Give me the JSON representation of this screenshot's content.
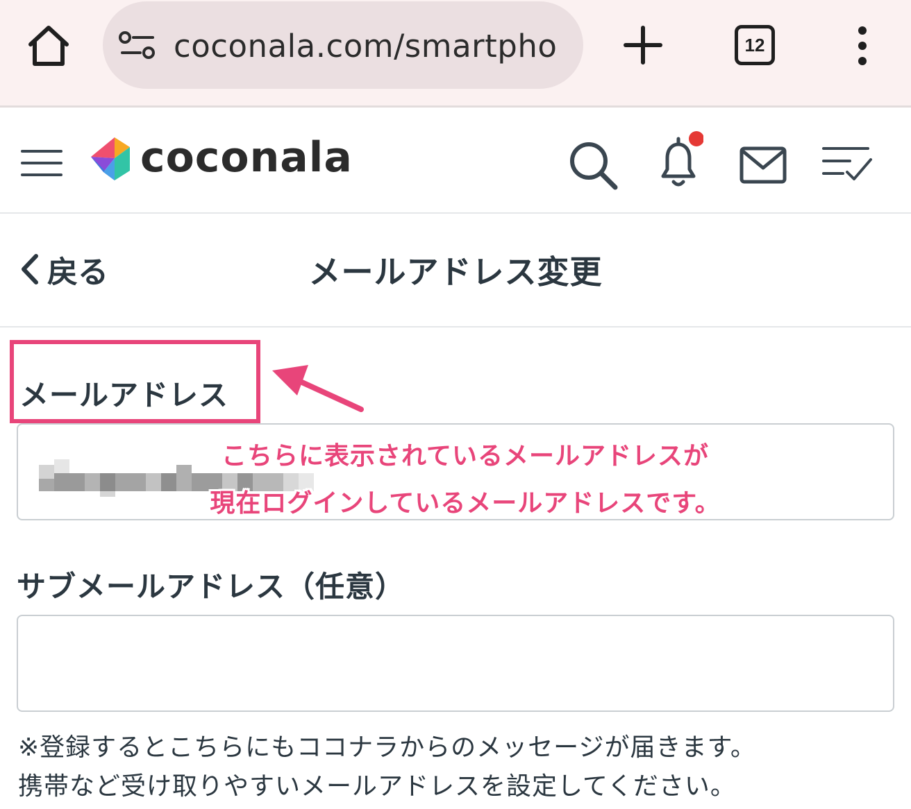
{
  "browser": {
    "url": "coconala.com/smartpho",
    "tab_count": "12"
  },
  "header": {
    "logo_text": "coconala",
    "notification_dot_color": "#e53935"
  },
  "page": {
    "back_label": "戻る",
    "title": "メールアドレス変更"
  },
  "form": {
    "email_label": "メールアドレス",
    "sub_email_label": "サブメールアドレス（任意）",
    "sub_email_value": "",
    "note_line1": "※登録するとこちらにもココナラからのメッセージが届きます。",
    "note_line2": "携帯など受け取りやすいメールアドレスを設定してください。"
  },
  "annotation": {
    "line1": "こちらに表示されているメールアドレスが",
    "line2": "現在ログインしているメールアドレスです。",
    "color": "#e8457a"
  }
}
